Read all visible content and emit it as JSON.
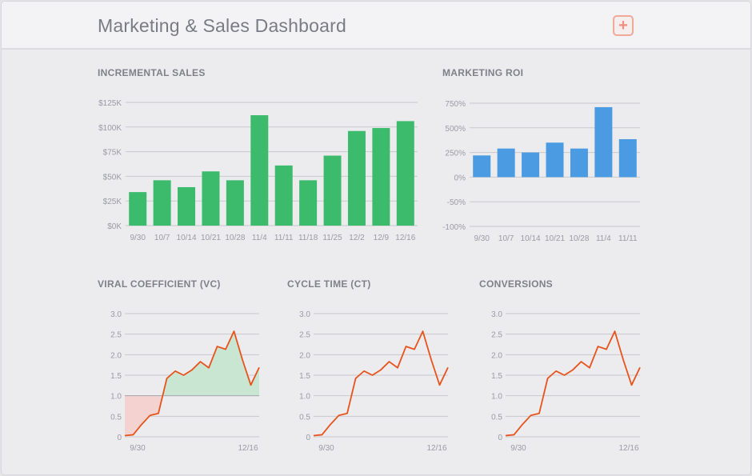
{
  "header": {
    "title": "Marketing & Sales Dashboard",
    "add_icon": "plus-icon",
    "accent_color": "#ef8f7b"
  },
  "panels": {
    "incremental_sales": "INCREMENTAL SALES",
    "marketing_roi": "MARKETING ROI",
    "viral_coefficient": "VIRAL COEFFICIENT (VC)",
    "cycle_time": "CYCLE TIME (CT)",
    "conversions": "CONVERSIONS"
  },
  "chart_data": [
    {
      "id": "incremental_sales",
      "type": "bar",
      "title": "INCREMENTAL SALES",
      "categories": [
        "9/30",
        "10/7",
        "10/14",
        "10/21",
        "10/28",
        "11/4",
        "11/11",
        "11/18",
        "11/25",
        "12/2",
        "12/9",
        "12/16"
      ],
      "values": [
        34,
        46,
        39,
        55,
        46,
        112,
        61,
        46,
        71,
        96,
        99,
        106
      ],
      "ylim": [
        0,
        125
      ],
      "yticks": [
        "$0K",
        "$25K",
        "$50K",
        "$75K",
        "$100K",
        "$125K"
      ],
      "unit": "$K",
      "color": "#3dbb6d",
      "grid": true
    },
    {
      "id": "marketing_roi",
      "type": "bar",
      "title": "MARKETING ROI",
      "categories": [
        "9/30",
        "10/7",
        "10/14",
        "10/21",
        "10/28",
        "11/4",
        "11/11"
      ],
      "values": [
        220,
        290,
        250,
        350,
        290,
        710,
        385
      ],
      "ylim": [
        -1000,
        750
      ],
      "yticks": [
        "-100%",
        "-50%",
        "0%",
        "250%",
        "500%",
        "750%"
      ],
      "color": "#4a9be2",
      "grid": true
    },
    {
      "id": "viral_coefficient",
      "type": "line",
      "title": "VIRAL COEFFICIENT (VC)",
      "xticks": [
        "9/30",
        "12/16"
      ],
      "yticks": [
        "0",
        "0.5",
        "1.0",
        "1.5",
        "2.0",
        "2.5",
        "3.0"
      ],
      "ylim": [
        0,
        3
      ],
      "threshold": 1.0,
      "values": [
        0.03,
        0.05,
        0.3,
        0.52,
        0.57,
        1.42,
        1.6,
        1.5,
        1.63,
        1.83,
        1.68,
        2.2,
        2.13,
        2.57,
        1.88,
        1.26,
        1.69
      ],
      "color": "#e8531c",
      "fill_above": "#c8e6d2",
      "fill_below": "#f3d2d0",
      "grid": true
    },
    {
      "id": "cycle_time",
      "type": "line",
      "title": "CYCLE TIME (CT)",
      "xticks": [
        "9/30",
        "12/16"
      ],
      "yticks": [
        "0",
        "0.5",
        "1.0",
        "1.5",
        "2.0",
        "2.5",
        "3.0"
      ],
      "ylim": [
        0,
        3
      ],
      "values": [
        0.03,
        0.05,
        0.3,
        0.52,
        0.57,
        1.42,
        1.6,
        1.5,
        1.63,
        1.83,
        1.68,
        2.2,
        2.13,
        2.57,
        1.88,
        1.26,
        1.69
      ],
      "color": "#e8531c",
      "grid": true
    },
    {
      "id": "conversions",
      "type": "line",
      "title": "CONVERSIONS",
      "xticks": [
        "9/30",
        "12/16"
      ],
      "yticks": [
        "0",
        "0.5",
        "1.0",
        "1.5",
        "2.0",
        "2.5",
        "3.0"
      ],
      "ylim": [
        0,
        3
      ],
      "values": [
        0.03,
        0.05,
        0.3,
        0.52,
        0.57,
        1.42,
        1.6,
        1.5,
        1.63,
        1.83,
        1.68,
        2.2,
        2.13,
        2.57,
        1.88,
        1.26,
        1.69
      ],
      "color": "#e8531c",
      "grid": true
    }
  ]
}
